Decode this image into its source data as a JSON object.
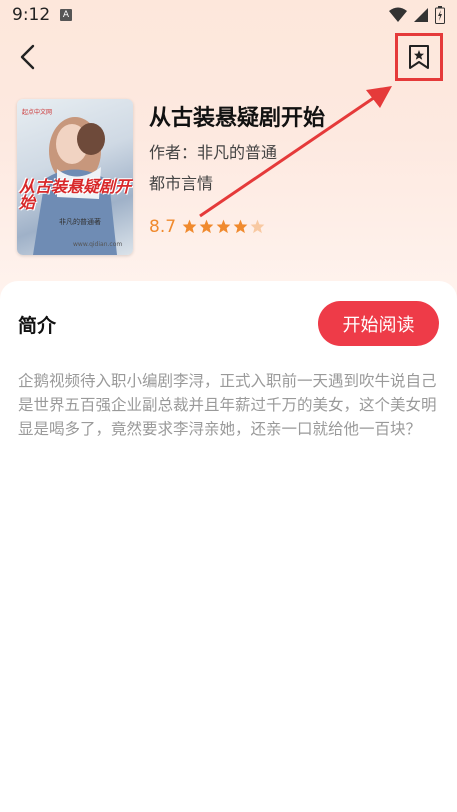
{
  "status_bar": {
    "time": "9:12",
    "notification_icon": "A"
  },
  "book": {
    "title": "从古装悬疑剧开始",
    "author": "作者：非凡的普通",
    "genre": "都市言情",
    "rating": "8.7",
    "rating_stars": 4.5,
    "cover": {
      "badge": "起点中文网",
      "title": "从古装悬疑剧开始",
      "author": "非凡的普通著",
      "site": "www.qidian.com"
    }
  },
  "intro": {
    "heading": "简介",
    "read_button": "开始阅读",
    "synopsis": "企鹅视频待入职小编剧李浔，正式入职前一天遇到吹牛说自己是世界五百强企业副总裁并且年薪过千万的美女，这个美女明显是喝多了，竟然要求李浔亲她，还亲一口就给他一百块？"
  },
  "colors": {
    "accent_red": "#ee3b48",
    "rating_orange": "#f08a2e",
    "annotation_red": "#e53a3a"
  },
  "icons": [
    "back-arrow-icon",
    "bookmark-star-icon",
    "wifi-icon",
    "signal-icon",
    "battery-icon",
    "star-icon"
  ]
}
